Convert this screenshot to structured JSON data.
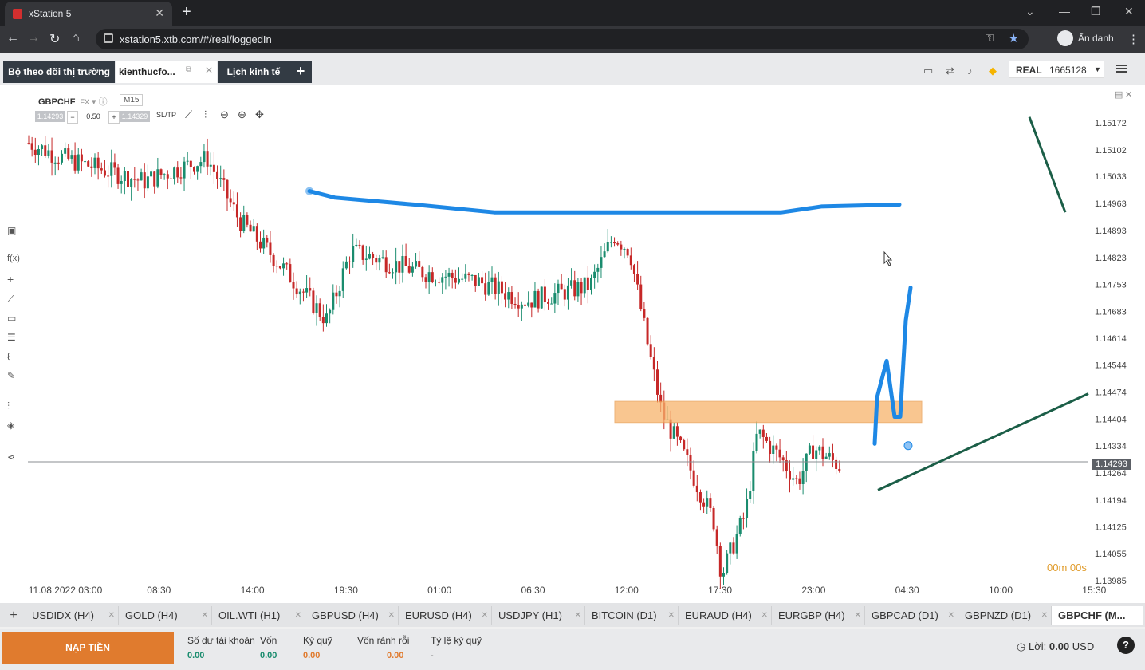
{
  "browser": {
    "tab_title": "xStation 5",
    "url": "xstation5.xtb.com/#/real/loggedIn",
    "profile_label": "Ẩn danh"
  },
  "app": {
    "tabs": [
      {
        "label": "Bộ theo dõi thị trường"
      },
      {
        "label": "kienthucfo..."
      },
      {
        "label": "Lịch kinh tế"
      },
      {
        "label": "+"
      }
    ],
    "account": {
      "mode": "REAL",
      "number": "1665128"
    }
  },
  "chart": {
    "symbol": "GBPCHF",
    "market": "FX",
    "timeframe": "M15",
    "sell_price": "1.14293",
    "volume": "0.50",
    "buy_price": "1.14329",
    "sltp_label": "SL/TP",
    "current_price": "1.14293",
    "timer": "00m 00s"
  },
  "chart_data": {
    "type": "candlestick",
    "y_ticks": [
      "1.15172",
      "1.15102",
      "1.15033",
      "1.14963",
      "1.14893",
      "1.14823",
      "1.14753",
      "1.14683",
      "1.14614",
      "1.14544",
      "1.14474",
      "1.14404",
      "1.14334",
      "1.14264",
      "1.14194",
      "1.14125",
      "1.14055",
      "1.13985"
    ],
    "x_ticks": [
      "11.08.2022 03:00",
      "08:30",
      "14:00",
      "19:30",
      "01:00",
      "06:30",
      "12:00",
      "17:30",
      "23:00",
      "04:30",
      "10:00",
      "15:30"
    ],
    "ylim": [
      1.13985,
      1.15172
    ],
    "current_price": 1.14293,
    "colors": {
      "up": "#1a8c6e",
      "down": "#c62828",
      "drawing_blue": "#1e88e5",
      "trend_green": "#1b5e47",
      "zone": "#f8b36b"
    }
  },
  "symbol_tabs": [
    {
      "label": "USDIDX (H4)"
    },
    {
      "label": "GOLD (H4)"
    },
    {
      "label": "OIL.WTI (H1)"
    },
    {
      "label": "GBPUSD (H4)"
    },
    {
      "label": "EURUSD (H4)"
    },
    {
      "label": "USDJPY (H1)"
    },
    {
      "label": "BITCOIN (D1)"
    },
    {
      "label": "EURAUD (H4)"
    },
    {
      "label": "EURGBP (H4)"
    },
    {
      "label": "GBPCAD (D1)"
    },
    {
      "label": "GBPNZD (D1)"
    },
    {
      "label": "GBPCHF (M..."
    }
  ],
  "footer": {
    "deposit_label": "NẠP TIỀN",
    "stats": [
      {
        "label": "Số dư tài khoản",
        "value": "0.00"
      },
      {
        "label": "Vốn",
        "value": "0.00"
      },
      {
        "label": "Ký quỹ",
        "value": "0.00"
      },
      {
        "label": "Vốn rảnh rỗi",
        "value": "0.00"
      },
      {
        "label": "Tỷ lệ ký quỹ",
        "value": "-"
      }
    ],
    "profit_label": "Lời:",
    "profit_value": "0.00",
    "currency": "USD",
    "help": "?"
  }
}
